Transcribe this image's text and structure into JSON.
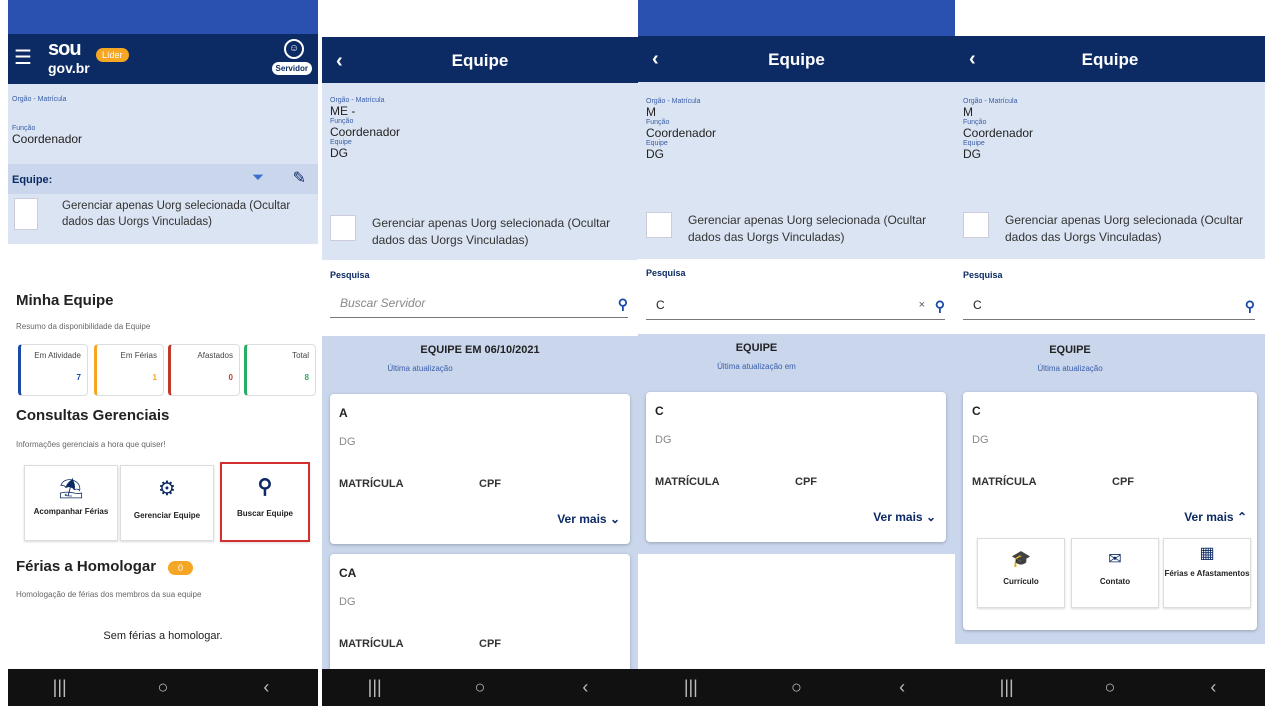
{
  "colors": {
    "header": "#0c2a63",
    "accent_strip": "#2a51b0",
    "info_bg": "#dbe4f2",
    "band_bg": "#c9d6ec",
    "highlight_border": "#d32f2f",
    "lider_badge": "#f5a623"
  },
  "s1": {
    "logo_top": "sou",
    "logo_bottom": "gov.br",
    "lider_badge": "Líder",
    "servidor_badge": "Servidor",
    "orgao_label": "Orgão - Matrícula",
    "funcao_label": "Função",
    "funcao_value": "Coordenador",
    "equipe_label": "Equipe:",
    "checkbox_text": "Gerenciar apenas Uorg selecionada (Ocultar dados das Uorgs Vinculadas)",
    "minha_equipe_title": "Minha Equipe",
    "minha_equipe_sub": "Resumo da disponibilidade da Equipe",
    "stats": [
      {
        "label": "Em Atividade",
        "value": "7",
        "color": "#1a4aa8"
      },
      {
        "label": "Em Férias",
        "value": "1",
        "color": "#f5a623"
      },
      {
        "label": "Afastados",
        "value": "0",
        "color": "#c0392b"
      },
      {
        "label": "Total",
        "value": "8",
        "color": "#27ae60"
      }
    ],
    "consultas_title": "Consultas Gerenciais",
    "consultas_sub": "Informações gerenciais a hora que quiser!",
    "tiles": [
      {
        "label": "Acompanhar Férias",
        "icon": "beach-umbrella-icon"
      },
      {
        "label": "Gerenciar Equipe",
        "icon": "team-gear-icon"
      },
      {
        "label": "Buscar Equipe",
        "icon": "search-icon"
      }
    ],
    "ferias_title": "Férias a Homologar",
    "ferias_count": "0",
    "ferias_sub": "Homologação de férias dos membros da sua equipe",
    "ferias_empty": "Sem férias a homologar."
  },
  "s2": {
    "title": "Equipe",
    "orgao_label": "Orgão - Matrícula",
    "orgao_value": "ME -",
    "funcao_label": "Função",
    "funcao_value": "Coordenador",
    "equipe_label": "Equipe",
    "equipe_value": "DG",
    "checkbox_text": "Gerenciar apenas Uorg selecionada (Ocultar dados das Uorgs Vinculadas)",
    "search_label": "Pesquisa",
    "search_placeholder": "Buscar Servidor",
    "equipe_title": "EQUIPE EM 06/10/2021",
    "equipe_sub": "Última atualização",
    "cards": [
      {
        "name": "A",
        "org": "DG",
        "mat": "MATRÍCULA",
        "cpf": "CPF",
        "more": "Ver mais"
      },
      {
        "name": "CA",
        "org": "DG",
        "mat": "MATRÍCULA",
        "cpf": "CPF"
      }
    ]
  },
  "s3": {
    "title": "Equipe",
    "orgao_label": "Orgão - Matrícula",
    "orgao_value": "M",
    "funcao_label": "Função",
    "funcao_value": "Coordenador",
    "equipe_label": "Equipe",
    "equipe_value": "DG",
    "checkbox_text": "Gerenciar apenas Uorg selecionada (Ocultar dados das Uorgs Vinculadas)",
    "search_label": "Pesquisa",
    "search_value": "C",
    "equipe_title": "EQUIPE",
    "equipe_sub": "Última atualização em",
    "card": {
      "name": "C",
      "org": "DG",
      "mat": "MATRÍCULA",
      "cpf": "CPF",
      "more": "Ver mais"
    }
  },
  "s4": {
    "title": "Equipe",
    "orgao_label": "Orgão - Matrícula",
    "orgao_value": "M",
    "funcao_label": "Função",
    "funcao_value": "Coordenador",
    "equipe_label": "Equipe",
    "equipe_value": "DG",
    "checkbox_text": "Gerenciar apenas Uorg selecionada (Ocultar dados das Uorgs Vinculadas)",
    "search_label": "Pesquisa",
    "search_value": "C",
    "equipe_title": "EQUIPE",
    "equipe_sub": "Última atualização",
    "card": {
      "name": "C",
      "org": "DG",
      "mat": "MATRÍCULA",
      "cpf": "CPF",
      "more": "Ver mais"
    },
    "actions": [
      {
        "label": "Currículo",
        "icon": "graduation-icon"
      },
      {
        "label": "Contato",
        "icon": "envelope-icon"
      },
      {
        "label": "Férias e Afastamentos",
        "icon": "calendar-icon"
      }
    ]
  },
  "nav": {
    "recent": "|||",
    "home": "○",
    "back": "‹"
  }
}
